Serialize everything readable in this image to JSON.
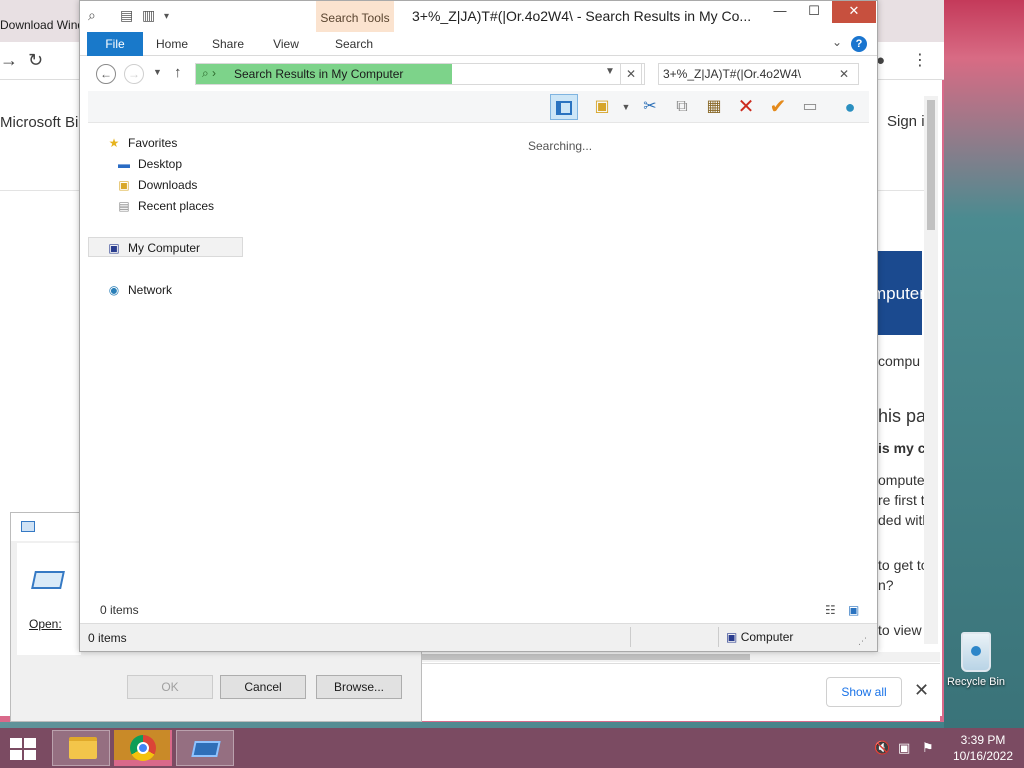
{
  "chrome_bg": {
    "tab_text": "Download Wind",
    "bing_text": "Microsoft Bin",
    "signin_text": "Sign i",
    "banner_text": "mputer",
    "side_lines": [
      "compu",
      "his pag",
      "is my c",
      "ompute",
      "re first t",
      "ded with",
      "to get to",
      "n?",
      "to view"
    ],
    "show_all": "Show all",
    "close_glyph": "✕"
  },
  "explorer": {
    "window_title": "3+%_Z|JA)T#(|Or.4o2W4\\ - Search Results in My Co...",
    "context_tab": "Search Tools",
    "ribbon_tabs": [
      "File",
      "Home",
      "Share",
      "View",
      "Search"
    ],
    "help_glyph": "?",
    "address_text": "Search Results in My Computer",
    "search_query": "3+%_Z|JA)T#(|Or.4o2W4\\",
    "status_searching": "Searching...",
    "items_count": "0 items",
    "status_items": "0 items",
    "status_location": "Computer",
    "nav": {
      "favorites": "Favorites",
      "desktop": "Desktop",
      "downloads": "Downloads",
      "recent": "Recent places",
      "my_computer": "My Computer",
      "network": "Network"
    }
  },
  "run_dialog": {
    "open_label": "Open:",
    "ok_label": "OK",
    "cancel_label": "Cancel",
    "browse_label": "Browse..."
  },
  "desktop": {
    "recycle_bin": "Recycle Bin"
  },
  "taskbar": {
    "time": "3:39 PM",
    "date": "10/16/2022"
  },
  "colors": {
    "file_tab": "#1979ca",
    "address_progress": "#7dd38a",
    "context_tab": "#fbe3cf",
    "close_button": "#c7503e",
    "taskbar": "#7b4b62"
  }
}
